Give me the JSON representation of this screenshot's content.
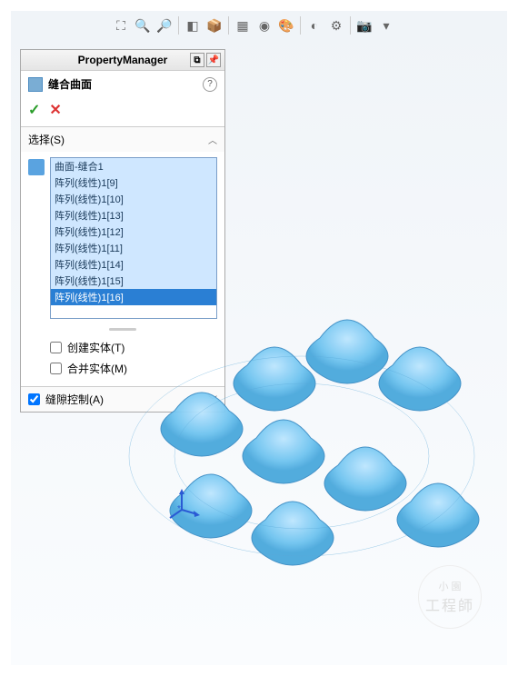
{
  "panel": {
    "title": "PropertyManager",
    "feature_name": "缝合曲面",
    "help": "?",
    "ok": "✓",
    "cancel": "✕"
  },
  "selection": {
    "header": "选择(S)",
    "items": [
      "曲面-缝合1",
      "阵列(线性)1[9]",
      "阵列(线性)1[10]",
      "阵列(线性)1[13]",
      "阵列(线性)1[12]",
      "阵列(线性)1[11]",
      "阵列(线性)1[14]",
      "阵列(线性)1[15]",
      "阵列(线性)1[16]"
    ],
    "selected_index": 8
  },
  "options": {
    "create_solid": "创建实体(T)",
    "merge_entities": "合并实体(M)"
  },
  "gap_control": {
    "header": "缝隙控制(A)"
  },
  "watermark": {
    "small": "小 園",
    "big": "工程師"
  }
}
